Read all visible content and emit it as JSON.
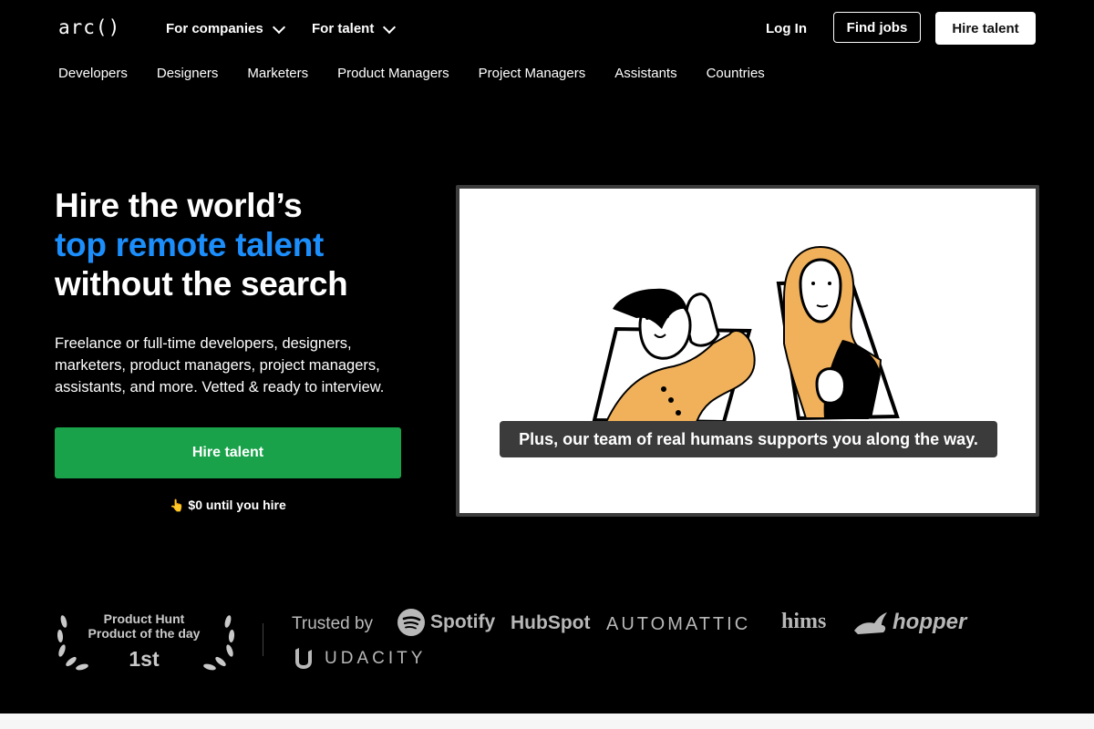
{
  "nav": {
    "logo": "arc()",
    "for_companies": "For companies",
    "for_talent": "For talent",
    "log_in": "Log In",
    "find_jobs": "Find jobs",
    "hire_talent": "Hire talent"
  },
  "categories": [
    "Developers",
    "Designers",
    "Marketers",
    "Product Managers",
    "Project Managers",
    "Assistants",
    "Countries"
  ],
  "hero": {
    "line1": "Hire the world’s",
    "line2": "top remote talent",
    "line3": "without the search",
    "description": "Freelance or full-time developers, designers, marketers, product managers, project managers, assistants, and more. Vetted & ready to interview.",
    "cta": "Hire talent",
    "fine_icon": "👆",
    "fine_text": "$0 until you hire"
  },
  "video": {
    "caption": "Plus, our team of real humans supports you along the way."
  },
  "badge": {
    "line1": "Product Hunt",
    "line2": "Product of the day",
    "rank": "1st"
  },
  "trust": {
    "label": "Trusted by",
    "brands": [
      "Spotify",
      "HubSpot",
      "AUTOMATTIC",
      "hims",
      "hopper",
      "UDACITY"
    ]
  },
  "colors": {
    "accent_blue": "#1b8efb",
    "cta_green": "#19a24a",
    "illustration_orange": "#f1b15a"
  }
}
